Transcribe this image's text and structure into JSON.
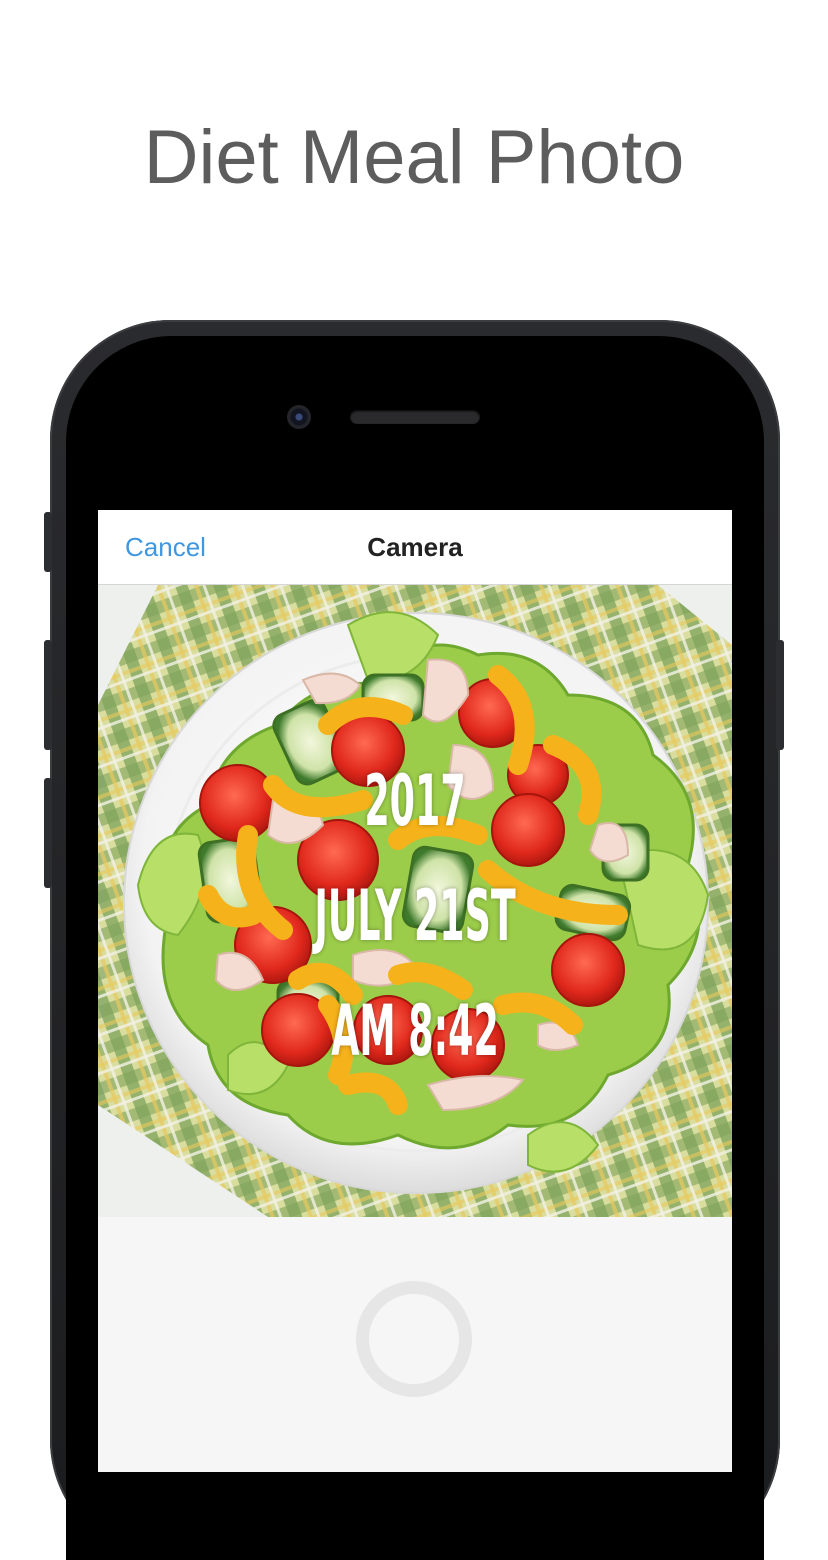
{
  "headline": "Diet Meal Photo",
  "navbar": {
    "cancel_label": "Cancel",
    "title": "Camera"
  },
  "photo_overlay": {
    "year": "2017",
    "date": "JULY 21ST",
    "time": "AM 8:42"
  },
  "colors": {
    "headline": "#5d5d5d",
    "cancel_link": "#3f97e0",
    "phone_body": "#1f2022"
  },
  "icons": {
    "shutter": "shutter-button-ring"
  }
}
